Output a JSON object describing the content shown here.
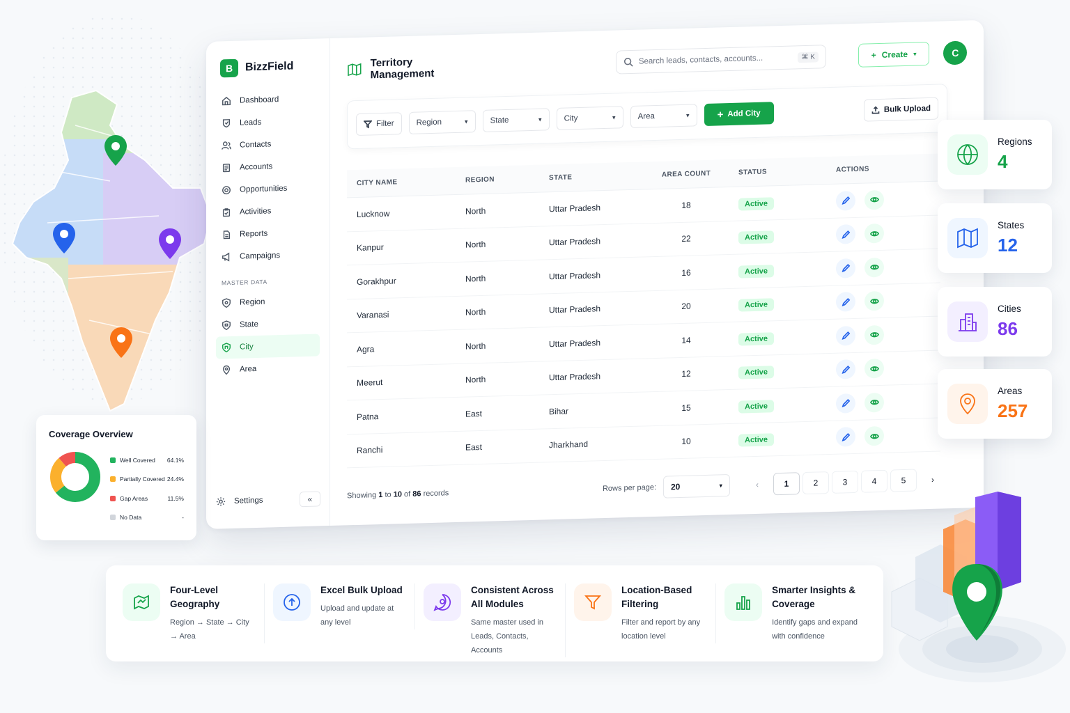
{
  "brand": {
    "logo_letter": "B",
    "name": "BizzField"
  },
  "sidebar": {
    "items": [
      {
        "label": "Dashboard",
        "icon": "home-icon"
      },
      {
        "label": "Leads",
        "icon": "leads-icon"
      },
      {
        "label": "Contacts",
        "icon": "contacts-icon"
      },
      {
        "label": "Accounts",
        "icon": "accounts-icon"
      },
      {
        "label": "Opportunities",
        "icon": "target-icon"
      },
      {
        "label": "Activities",
        "icon": "clipboard-icon"
      },
      {
        "label": "Reports",
        "icon": "report-icon"
      },
      {
        "label": "Campaigns",
        "icon": "megaphone-icon"
      }
    ],
    "master_label": "MASTER DATA",
    "master_items": [
      {
        "label": "Region",
        "icon": "shield-icon"
      },
      {
        "label": "State",
        "icon": "shield-icon"
      },
      {
        "label": "City",
        "icon": "building-icon"
      },
      {
        "label": "Area",
        "icon": "pin-icon"
      }
    ],
    "settings_label": "Settings",
    "collapse_label": "«"
  },
  "header": {
    "title": "Territory Management",
    "search_placeholder": "Search leads, contacts, accounts...",
    "search_shortcut": "⌘ K",
    "create_label": "Create",
    "avatar_letter": "C"
  },
  "filters": {
    "filter_label": "Filter",
    "region": "Region",
    "state": "State",
    "city": "City",
    "area": "Area",
    "add_city": "Add City",
    "bulk_upload": "Bulk Upload"
  },
  "table": {
    "columns": [
      "CITY NAME",
      "REGION",
      "STATE",
      "AREA COUNT",
      "STATUS",
      "ACTIONS"
    ],
    "rows": [
      {
        "city": "Lucknow",
        "region": "North",
        "state": "Uttar Pradesh",
        "count": "18",
        "status": "Active"
      },
      {
        "city": "Kanpur",
        "region": "North",
        "state": "Uttar Pradesh",
        "count": "22",
        "status": "Active"
      },
      {
        "city": "Gorakhpur",
        "region": "North",
        "state": "Uttar Pradesh",
        "count": "16",
        "status": "Active"
      },
      {
        "city": "Varanasi",
        "region": "North",
        "state": "Uttar Pradesh",
        "count": "20",
        "status": "Active"
      },
      {
        "city": "Agra",
        "region": "North",
        "state": "Uttar Pradesh",
        "count": "14",
        "status": "Active"
      },
      {
        "city": "Meerut",
        "region": "North",
        "state": "Uttar Pradesh",
        "count": "12",
        "status": "Active"
      },
      {
        "city": "Patna",
        "region": "East",
        "state": "Bihar",
        "count": "15",
        "status": "Active"
      },
      {
        "city": "Ranchi",
        "region": "East",
        "state": "Jharkhand",
        "count": "10",
        "status": "Active"
      }
    ]
  },
  "footer": {
    "showing_prefix": "Showing",
    "from": "1",
    "to_word": "to",
    "to": "10",
    "of_word": "of",
    "total": "86",
    "records_word": "records",
    "rows_per_page_label": "Rows per page:",
    "rows_per_page_value": "20",
    "pages": [
      "1",
      "2",
      "3",
      "4",
      "5"
    ],
    "current_page": "1"
  },
  "stats": [
    {
      "label": "Regions",
      "value": "4",
      "color": "#16a34a",
      "bg": "#ecfdf3",
      "icon": "globe-icon"
    },
    {
      "label": "States",
      "value": "12",
      "color": "#2563eb",
      "bg": "#eff6ff",
      "icon": "map-icon"
    },
    {
      "label": "Cities",
      "value": "86",
      "color": "#7c3aed",
      "bg": "#f3efff",
      "icon": "city-icon"
    },
    {
      "label": "Areas",
      "value": "257",
      "color": "#f97316",
      "bg": "#fff4eb",
      "icon": "location-icon"
    }
  ],
  "coverage": {
    "title": "Coverage Overview",
    "items": [
      {
        "label": "Well Covered",
        "pct": "64.1%",
        "value": 64.1,
        "color": "#22b35e"
      },
      {
        "label": "Partially Covered",
        "pct": "24.4%",
        "value": 24.4,
        "color": "#fbb02d"
      },
      {
        "label": "Gap Areas",
        "pct": "11.5%",
        "value": 11.5,
        "color": "#ef5350"
      },
      {
        "label": "No Data",
        "pct": "-",
        "value": 0,
        "color": "#d1d5db"
      }
    ]
  },
  "features": [
    {
      "title": "Four-Level Geography",
      "desc": "Region → State → City → Area",
      "color": "#16a34a",
      "bg": "#ecfdf3",
      "icon": "geography-icon"
    },
    {
      "title": "Excel Bulk Upload",
      "desc": "Upload and update at any level",
      "color": "#2563eb",
      "bg": "#eff6ff",
      "icon": "upload-icon"
    },
    {
      "title": "Consistent Across All Modules",
      "desc": "Same master used in Leads, Contacts, Accounts",
      "color": "#7c3aed",
      "bg": "#f3efff",
      "icon": "chat-pin-icon"
    },
    {
      "title": "Location-Based Filtering",
      "desc": "Filter and report by any location level",
      "color": "#f97316",
      "bg": "#fff4eb",
      "icon": "funnel-icon"
    },
    {
      "title": "Smarter Insights & Coverage",
      "desc": "Identify gaps and expand with confidence",
      "color": "#16a34a",
      "bg": "#ecfdf3",
      "icon": "bar-chart-icon"
    }
  ]
}
